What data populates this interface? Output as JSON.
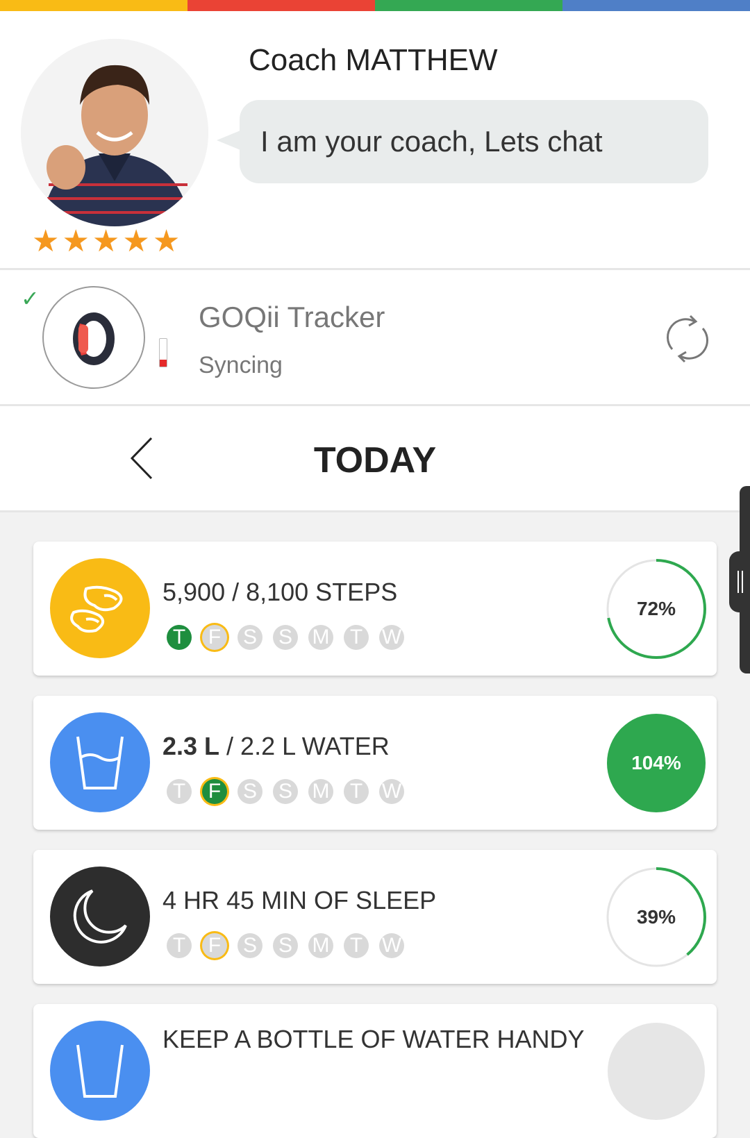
{
  "colors": {
    "top_bar": [
      "#f9bb15",
      "#ea4335",
      "#34a853",
      "#4f7fc7"
    ],
    "accent_green": "#1e8e3e",
    "accent_yellow": "#f9bb15",
    "steps_icon_bg": "#f9bb15",
    "water_icon_bg": "#4a8ff0",
    "sleep_icon_bg": "#2d2d2d",
    "star": "#f5981f"
  },
  "coach": {
    "name": "Coach MATTHEW",
    "message": "I am your coach, Lets chat",
    "rating": 5,
    "avatar_icon": "coach-photo"
  },
  "tracker": {
    "name": "GOQii Tracker",
    "status": "Syncing",
    "battery_level": 0.25,
    "connected_icon": "check-icon",
    "sync_icon": "refresh-icon"
  },
  "date_nav": {
    "title": "TODAY",
    "back_icon": "chevron-left-icon"
  },
  "cards": [
    {
      "id": "steps",
      "icon": "footprints-icon",
      "text_plain": "5,900 / 8,100 STEPS",
      "progress": 72,
      "progress_label": "72%",
      "days": [
        {
          "label": "T",
          "state": "done"
        },
        {
          "label": "F",
          "state": "current"
        },
        {
          "label": "S",
          "state": "off"
        },
        {
          "label": "S",
          "state": "off"
        },
        {
          "label": "M",
          "state": "off"
        },
        {
          "label": "T",
          "state": "off"
        },
        {
          "label": "W",
          "state": "off"
        }
      ]
    },
    {
      "id": "water",
      "icon": "water-glass-icon",
      "text_bold": "2.3 L",
      "text_rest": " / 2.2 L WATER",
      "progress": 104,
      "progress_label": "104%",
      "days": [
        {
          "label": "T",
          "state": "off"
        },
        {
          "label": "F",
          "state": "current-done"
        },
        {
          "label": "S",
          "state": "off"
        },
        {
          "label": "S",
          "state": "off"
        },
        {
          "label": "M",
          "state": "off"
        },
        {
          "label": "T",
          "state": "off"
        },
        {
          "label": "W",
          "state": "off"
        }
      ]
    },
    {
      "id": "sleep",
      "icon": "moon-icon",
      "text_plain": "4 HR 45 MIN OF SLEEP",
      "progress": 39,
      "progress_label": "39%",
      "days": [
        {
          "label": "T",
          "state": "off"
        },
        {
          "label": "F",
          "state": "current"
        },
        {
          "label": "S",
          "state": "off"
        },
        {
          "label": "S",
          "state": "off"
        },
        {
          "label": "M",
          "state": "off"
        },
        {
          "label": "T",
          "state": "off"
        },
        {
          "label": "W",
          "state": "off"
        }
      ]
    },
    {
      "id": "tip",
      "icon": "water-glass-icon",
      "text_plain": "KEEP A BOTTLE OF WATER HANDY"
    }
  ]
}
